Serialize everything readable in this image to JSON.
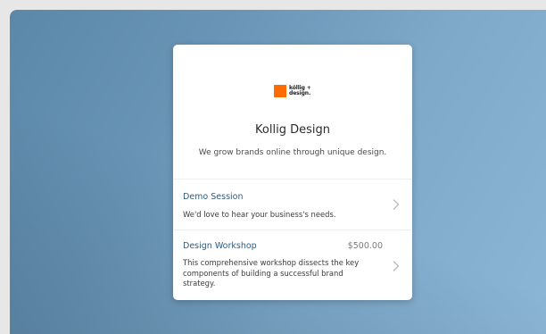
{
  "brand": {
    "logo_line1": "köllig +",
    "logo_line2": "design.",
    "logo_color": "#ff6b00"
  },
  "card": {
    "title": "Kollig Design",
    "tagline": "We grow brands online through unique design."
  },
  "services": [
    {
      "name": "Demo Session",
      "price": "",
      "description": "We'd love to hear your business's needs."
    },
    {
      "name": "Design Workshop",
      "price": "$500.00",
      "description": "This comprehensive workshop dissects the key components of building a successful brand strategy."
    }
  ],
  "colors": {
    "accent_text": "#2f5b7d",
    "background_gradient_start": "#5b87a8",
    "background_gradient_end": "#8cb6d5"
  },
  "icons": {
    "service_arrow": "chevron-right-icon"
  }
}
